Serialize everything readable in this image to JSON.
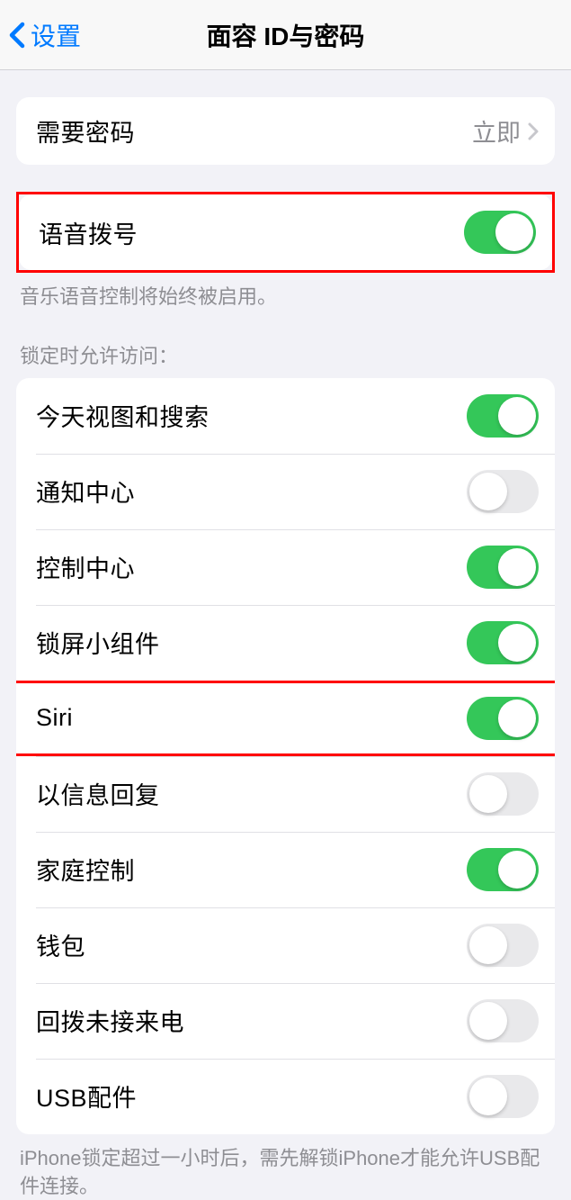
{
  "header": {
    "back_label": "设置",
    "title": "面容 ID与密码"
  },
  "require_passcode": {
    "label": "需要密码",
    "value": "立即"
  },
  "voice_dial": {
    "label": "语音拨号",
    "on": true,
    "footer": "音乐语音控制将始终被启用。"
  },
  "locked_access": {
    "header": "锁定时允许访问：",
    "items": [
      {
        "label": "今天视图和搜索",
        "on": true
      },
      {
        "label": "通知中心",
        "on": false
      },
      {
        "label": "控制中心",
        "on": true
      },
      {
        "label": "锁屏小组件",
        "on": true
      },
      {
        "label": "Siri",
        "on": true
      },
      {
        "label": "以信息回复",
        "on": false
      },
      {
        "label": "家庭控制",
        "on": true
      },
      {
        "label": "钱包",
        "on": false
      },
      {
        "label": "回拨未接来电",
        "on": false
      },
      {
        "label": "USB配件",
        "on": false
      }
    ],
    "footer": "iPhone锁定超过一小时后，需先解锁iPhone才能允许USB配件连接。"
  }
}
